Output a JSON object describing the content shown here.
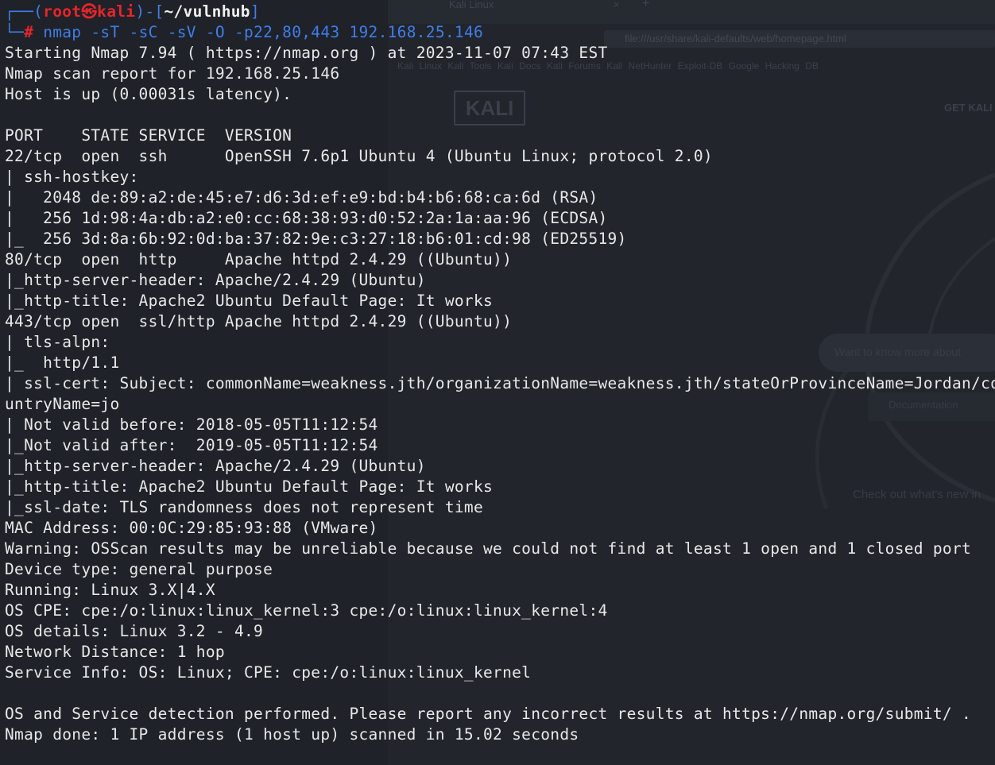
{
  "background": {
    "tab_title": "Kali Linux",
    "tab_close": "×",
    "tab_new": "+",
    "url": "file:///usr/share/kali-defaults/web/homepage.html",
    "bookmarks": "Kali Linux  Kali Tools  Kali Docs  Kali Forums  Kali NetHunter  Exploit-DB  Google Hacking DB",
    "logo": "KALI",
    "get_kali": "GET KALI",
    "search_placeholder": "Want to know more about",
    "documentation": "Documentation",
    "whats_new": "Check out what's new in"
  },
  "prompt": {
    "corner_top": "┌──(",
    "user": "root",
    "skull": "㉿",
    "host": "kali",
    "path_open": ")-[",
    "path": "~/vulnhub",
    "path_close": "]",
    "corner_bottom": "└─",
    "hash": "#",
    "command": "nmap -sT -sC -sV -O -p22,80,443 192.168.25.146"
  },
  "output": [
    "Starting Nmap 7.94 ( https://nmap.org ) at 2023-11-07 07:43 EST",
    "Nmap scan report for 192.168.25.146",
    "Host is up (0.00031s latency).",
    "",
    "PORT    STATE SERVICE  VERSION",
    "22/tcp  open  ssh      OpenSSH 7.6p1 Ubuntu 4 (Ubuntu Linux; protocol 2.0)",
    "| ssh-hostkey:",
    "|   2048 de:89:a2:de:45:e7:d6:3d:ef:e9:bd:b4:b6:68:ca:6d (RSA)",
    "|   256 1d:98:4a:db:a2:e0:cc:68:38:93:d0:52:2a:1a:aa:96 (ECDSA)",
    "|_  256 3d:8a:6b:92:0d:ba:37:82:9e:c3:27:18:b6:01:cd:98 (ED25519)",
    "80/tcp  open  http     Apache httpd 2.4.29 ((Ubuntu))",
    "|_http-server-header: Apache/2.4.29 (Ubuntu)",
    "|_http-title: Apache2 Ubuntu Default Page: It works",
    "443/tcp open  ssl/http Apache httpd 2.4.29 ((Ubuntu))",
    "| tls-alpn:",
    "|_  http/1.1",
    "| ssl-cert: Subject: commonName=weakness.jth/organizationName=weakness.jth/stateOrProvinceName=Jordan/co",
    "untryName=jo",
    "| Not valid before: 2018-05-05T11:12:54",
    "|_Not valid after:  2019-05-05T11:12:54",
    "|_http-server-header: Apache/2.4.29 (Ubuntu)",
    "|_http-title: Apache2 Ubuntu Default Page: It works",
    "|_ssl-date: TLS randomness does not represent time",
    "MAC Address: 00:0C:29:85:93:88 (VMware)",
    "Warning: OSScan results may be unreliable because we could not find at least 1 open and 1 closed port",
    "Device type: general purpose",
    "Running: Linux 3.X|4.X",
    "OS CPE: cpe:/o:linux:linux_kernel:3 cpe:/o:linux:linux_kernel:4",
    "OS details: Linux 3.2 - 4.9",
    "Network Distance: 1 hop",
    "Service Info: OS: Linux; CPE: cpe:/o:linux:linux_kernel",
    "",
    "OS and Service detection performed. Please report any incorrect results at https://nmap.org/submit/ .",
    "Nmap done: 1 IP address (1 host up) scanned in 15.02 seconds"
  ],
  "colors": {
    "background": "#1f2229",
    "prompt_blue": "#3f7ee8",
    "prompt_red": "#e8252a",
    "text": "#e8e8e8"
  }
}
